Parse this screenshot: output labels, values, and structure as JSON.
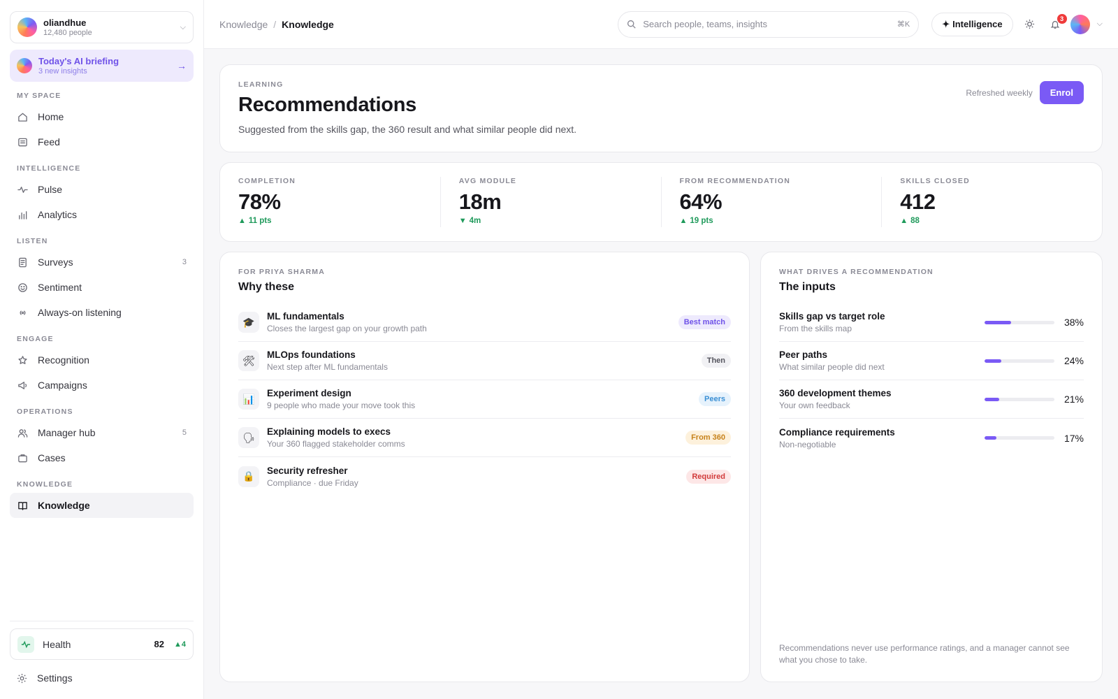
{
  "org": {
    "name": "oliandhue",
    "people": "12,480 people"
  },
  "briefing": {
    "title": "Today's AI briefing",
    "subtitle": "3 new insights"
  },
  "nav": {
    "sections": [
      {
        "heading": "MY SPACE",
        "items": [
          {
            "label": "Home",
            "icon": "home-icon"
          },
          {
            "label": "Feed",
            "icon": "feed-icon"
          }
        ]
      },
      {
        "heading": "INTELLIGENCE",
        "items": [
          {
            "label": "Pulse",
            "icon": "pulse-icon"
          },
          {
            "label": "Analytics",
            "icon": "analytics-icon"
          }
        ]
      },
      {
        "heading": "LISTEN",
        "items": [
          {
            "label": "Surveys",
            "icon": "surveys-icon",
            "count": "3"
          },
          {
            "label": "Sentiment",
            "icon": "smile-icon"
          },
          {
            "label": "Always-on listening",
            "icon": "radio-icon"
          }
        ]
      },
      {
        "heading": "ENGAGE",
        "items": [
          {
            "label": "Recognition",
            "icon": "star-icon"
          },
          {
            "label": "Campaigns",
            "icon": "megaphone-icon"
          }
        ]
      },
      {
        "heading": "OPERATIONS",
        "items": [
          {
            "label": "Manager hub",
            "icon": "people-icon",
            "count": "5"
          },
          {
            "label": "Cases",
            "icon": "briefcase-icon"
          }
        ]
      },
      {
        "heading": "KNOWLEDGE",
        "items": [
          {
            "label": "Knowledge",
            "icon": "book-icon"
          }
        ]
      }
    ],
    "active": "Knowledge"
  },
  "health": {
    "label": "Health",
    "value": "82",
    "delta": "4"
  },
  "settings": {
    "label": "Settings"
  },
  "breadcrumb": {
    "parent": "Knowledge",
    "separator": "/",
    "current": "Knowledge"
  },
  "search": {
    "placeholder": "Search people, teams, insights",
    "shortcut": "⌘K"
  },
  "intelligence": {
    "label": "Intelligence"
  },
  "notifications": {
    "count": "3"
  },
  "hero": {
    "eyebrow": "LEARNING",
    "title": "Recommendations",
    "subtitle": "Suggested from the skills gap, the 360 result and what similar people did next.",
    "refreshed": "Refreshed weekly",
    "action": "Enrol"
  },
  "stats": [
    {
      "label": "COMPLETION",
      "value": "78%",
      "delta": "11 pts",
      "direction": "up"
    },
    {
      "label": "AVG MODULE",
      "value": "18m",
      "delta": "4m",
      "direction": "down"
    },
    {
      "label": "FROM RECOMMENDATION",
      "value": "64%",
      "delta": "19 pts",
      "direction": "up"
    },
    {
      "label": "SKILLS CLOSED",
      "value": "412",
      "delta": "88",
      "direction": "up"
    }
  ],
  "why": {
    "eyebrow": "FOR PRIYA SHARMA",
    "title": "Why these",
    "items": [
      {
        "title": "ML fundamentals",
        "subtitle": "Closes the largest gap on your growth path",
        "tag": "Best match",
        "tag_color": "#6f52e8",
        "tag_bg": "#eeeafd",
        "icon": "graduation-cap-icon",
        "glyph": "🎓"
      },
      {
        "title": "MLOps foundations",
        "subtitle": "Next step after ML fundamentals",
        "tag": "Then",
        "tag_color": "#55555e",
        "tag_bg": "#f1f1f4",
        "icon": "tools-icon",
        "glyph": "🛠"
      },
      {
        "title": "Experiment design",
        "subtitle": "9 people who made your move took this",
        "tag": "Peers",
        "tag_color": "#3a8fd4",
        "tag_bg": "#e6f2fc",
        "icon": "chart-icon",
        "glyph": "📊"
      },
      {
        "title": "Explaining models to execs",
        "subtitle": "Your 360 flagged stakeholder comms",
        "tag": "From 360",
        "tag_color": "#c7821b",
        "tag_bg": "#fdf1dc",
        "icon": "speaking-head-icon",
        "glyph": "🗣"
      },
      {
        "title": "Security refresher",
        "subtitle": "Compliance · due Friday",
        "tag": "Required",
        "tag_color": "#d13b3b",
        "tag_bg": "#fde7e7",
        "icon": "lock-icon",
        "glyph": "🔒"
      }
    ]
  },
  "inputs": {
    "eyebrow": "WHAT DRIVES A RECOMMENDATION",
    "title": "The inputs",
    "items": [
      {
        "title": "Skills gap vs target role",
        "subtitle": "From the skills map",
        "value": 38,
        "label": "38%"
      },
      {
        "title": "Peer paths",
        "subtitle": "What similar people did next",
        "value": 24,
        "label": "24%"
      },
      {
        "title": "360 development themes",
        "subtitle": "Your own feedback",
        "value": 21,
        "label": "21%"
      },
      {
        "title": "Compliance requirements",
        "subtitle": "Non-negotiable",
        "value": 17,
        "label": "17%"
      }
    ],
    "footnote": "Recommendations never use performance ratings, and a manager cannot see what you chose to take."
  },
  "colors": {
    "accent": "#7a5af5",
    "positive": "#1f9a5b",
    "alert": "#ef3b3b"
  }
}
